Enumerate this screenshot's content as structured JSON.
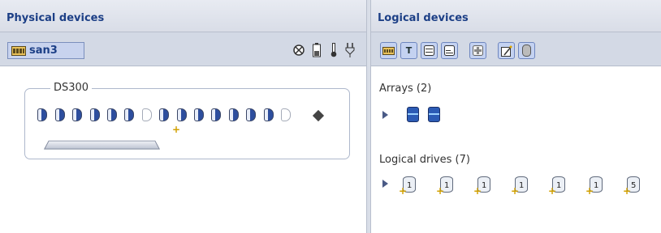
{
  "physical": {
    "header": "Physical devices",
    "server_name": "san3",
    "toolbar_icons": [
      "no-entry-icon",
      "battery-icon",
      "thermometer-icon",
      "power-plug-icon"
    ],
    "enclosure": {
      "name": "DS300",
      "slots": 14
    }
  },
  "logical": {
    "header": "Logical devices",
    "toolbar": {
      "text_view_label": "T"
    },
    "arrays_label": "Arrays (2)",
    "drives_label": "Logical drives (7)",
    "drives": [
      {
        "raid": "1"
      },
      {
        "raid": "1"
      },
      {
        "raid": "1"
      },
      {
        "raid": "1"
      },
      {
        "raid": "1"
      },
      {
        "raid": "1"
      },
      {
        "raid": "5"
      }
    ]
  }
}
